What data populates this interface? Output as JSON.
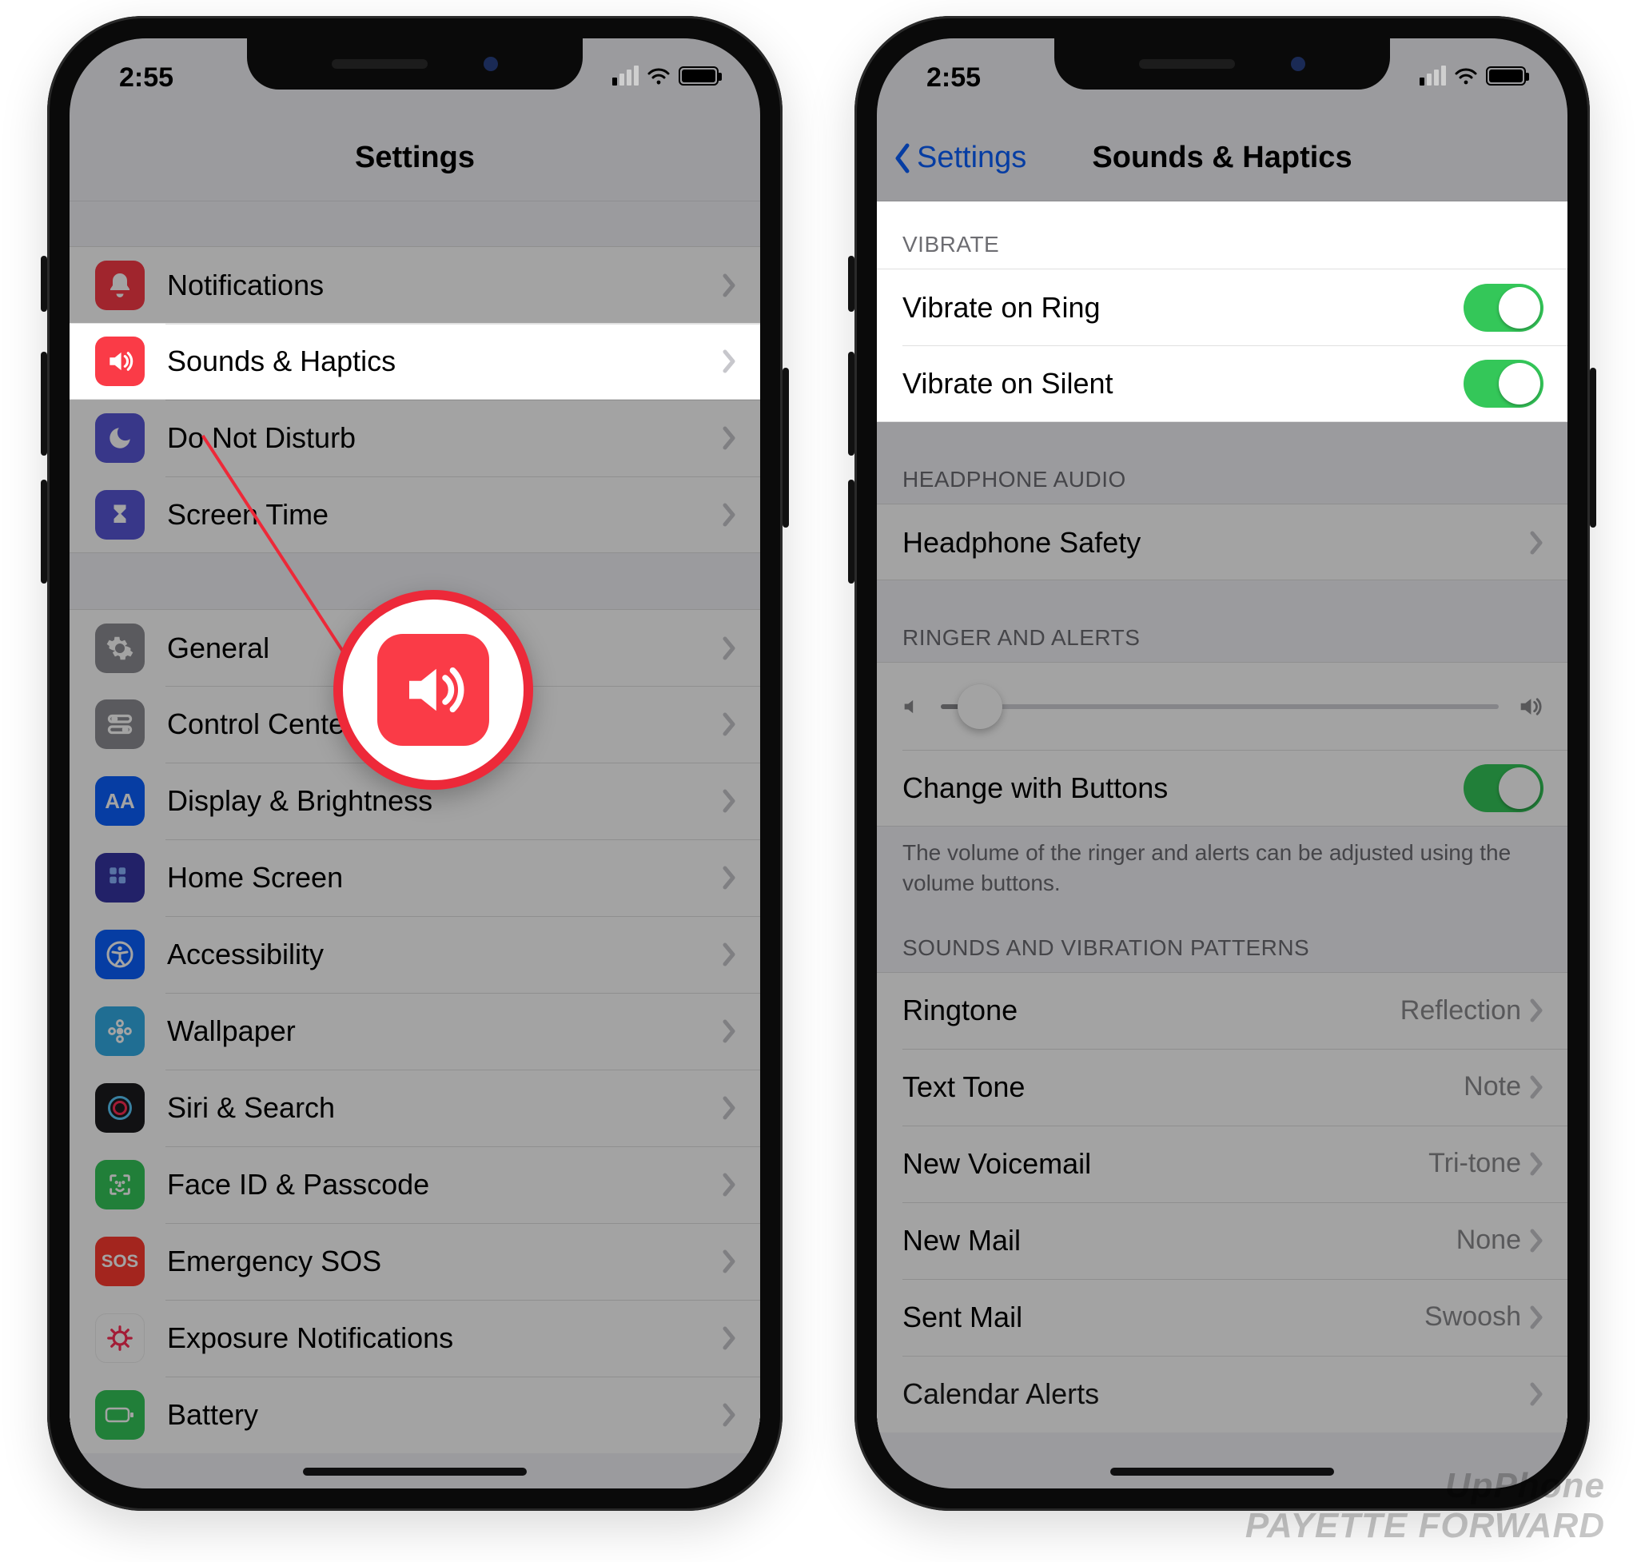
{
  "status": {
    "time": "2:55"
  },
  "watermark": {
    "line1": "UpPhone",
    "line2": "PAYETTE FORWARD"
  },
  "callout_icon": "speaker-icon",
  "colors": {
    "red": "#fa3b47",
    "purple": "#5856d6",
    "grey": "#8e8e93",
    "blue": "#0a60ff",
    "teal": "#32ade6",
    "green": "#34c759",
    "darkicon": "#1c1c1e",
    "sosred": "#ff3b30",
    "covidred": "#ff2d55"
  },
  "phone1": {
    "title": "Settings",
    "items": [
      {
        "icon": "bell-icon",
        "icon_bg": "#fa3b47",
        "label": "Notifications"
      },
      {
        "icon": "speaker-icon",
        "icon_bg": "#fa3b47",
        "label": "Sounds & Haptics",
        "highlight": true
      },
      {
        "icon": "moon-icon",
        "icon_bg": "#5856d6",
        "label": "Do Not Disturb"
      },
      {
        "icon": "hourglass-icon",
        "icon_bg": "#5856d6",
        "label": "Screen Time"
      }
    ],
    "items2": [
      {
        "icon": "gear-icon",
        "icon_bg": "#8e8e93",
        "label": "General"
      },
      {
        "icon": "toggles-icon",
        "icon_bg": "#8e8e93",
        "label": "Control Center"
      },
      {
        "icon": "aa-icon",
        "icon_bg": "#0a60ff",
        "label": "Display & Brightness"
      },
      {
        "icon": "grid-icon",
        "icon_bg": "#3634a3",
        "label": "Home Screen"
      },
      {
        "icon": "accessibility-icon",
        "icon_bg": "#0a60ff",
        "label": "Accessibility"
      },
      {
        "icon": "flower-icon",
        "icon_bg": "#32ade6",
        "label": "Wallpaper"
      },
      {
        "icon": "siri-icon",
        "icon_bg": "#1c1c1e",
        "label": "Siri & Search"
      },
      {
        "icon": "faceid-icon",
        "icon_bg": "#34c759",
        "label": "Face ID & Passcode"
      },
      {
        "icon": "sos-icon",
        "icon_bg": "#ff3b30",
        "label": "Emergency SOS",
        "text": "SOS"
      },
      {
        "icon": "covid-icon",
        "icon_bg": "#ffffff",
        "label": "Exposure Notifications",
        "fg": "#ff2d55"
      },
      {
        "icon": "battery-icon",
        "icon_bg": "#34c759",
        "label": "Battery"
      }
    ]
  },
  "phone2": {
    "back": "Settings",
    "title": "Sounds & Haptics",
    "section_vibrate": "VIBRATE",
    "vibrate_ring": {
      "label": "Vibrate on Ring",
      "on": true
    },
    "vibrate_silent": {
      "label": "Vibrate on Silent",
      "on": true
    },
    "section_headphone": "HEADPHONE AUDIO",
    "headphone_safety": "Headphone Safety",
    "section_ringer": "RINGER AND ALERTS",
    "change_buttons": {
      "label": "Change with Buttons",
      "on": true
    },
    "ringer_footer": "The volume of the ringer and alerts can be adjusted using the volume buttons.",
    "section_patterns": "SOUNDS AND VIBRATION PATTERNS",
    "patterns": [
      {
        "label": "Ringtone",
        "value": "Reflection"
      },
      {
        "label": "Text Tone",
        "value": "Note"
      },
      {
        "label": "New Voicemail",
        "value": "Tri-tone"
      },
      {
        "label": "New Mail",
        "value": "None"
      },
      {
        "label": "Sent Mail",
        "value": "Swoosh"
      }
    ],
    "cutoff_label": "Calendar Alerts"
  }
}
